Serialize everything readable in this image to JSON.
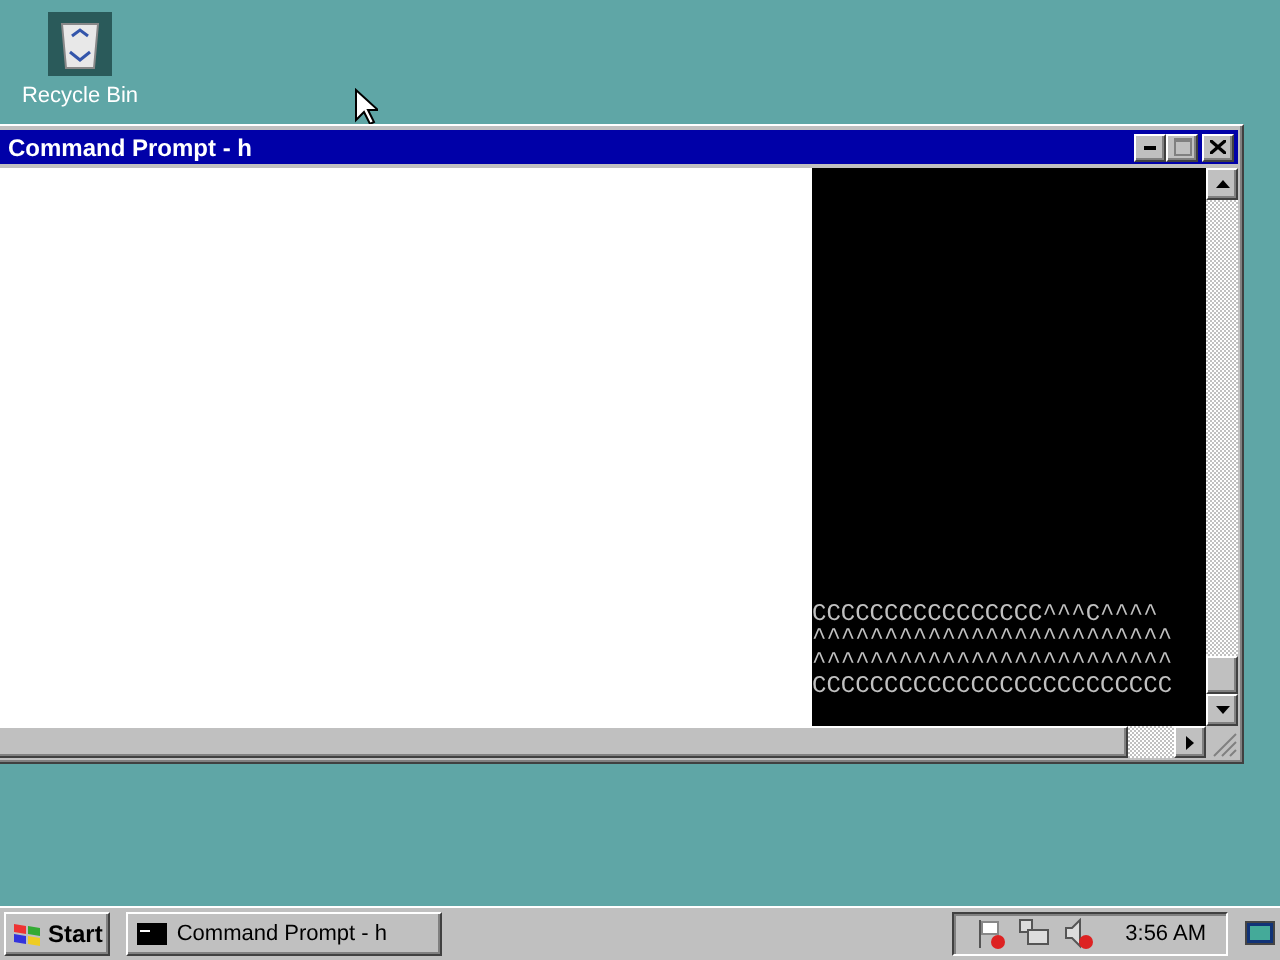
{
  "desktop_icons": [
    {
      "label": "Recycle Bin"
    }
  ],
  "window": {
    "title": "Command Prompt - h",
    "console_lines": [
      "CCCCCCCCCCCCCCCC^^^C^^^^",
      "^^^^^^^^^^^^^^^^^^^^^^^^^",
      "^^^^^^^^^^^^^^^^^^^^^^^^^",
      "CCCCCCCCCCCCCCCCCCCCCCCCC"
    ]
  },
  "taskbar": {
    "start": "Start",
    "tasks": [
      {
        "label": "Command Prompt - h",
        "selected": false
      }
    ],
    "clock": "3:56 AM"
  }
}
